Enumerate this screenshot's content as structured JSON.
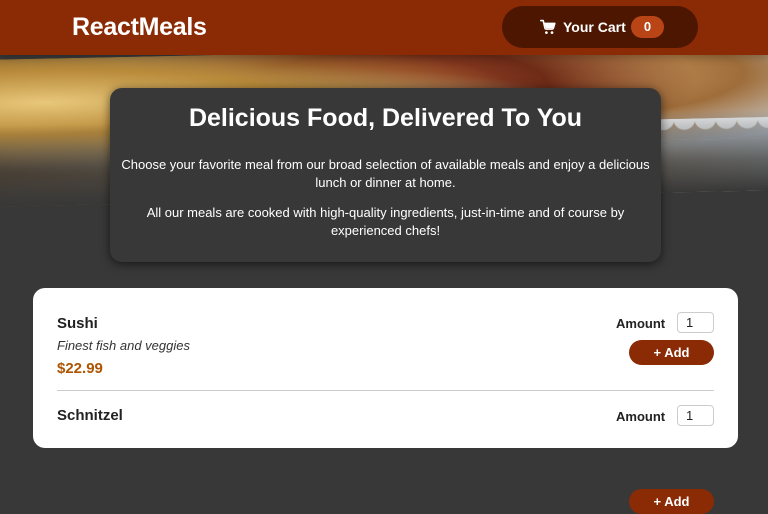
{
  "header": {
    "brand": "ReactMeals",
    "cart": {
      "label": "Your Cart",
      "count": "0",
      "icon": "cart-icon"
    }
  },
  "summary": {
    "title": "Delicious Food, Delivered To You",
    "paragraph1": "Choose your favorite meal from our broad selection of available meals and enjoy a delicious lunch or dinner at home.",
    "paragraph2": "All our meals are cooked with high-quality ingredients, just-in-time and of course by experienced chefs!"
  },
  "meals": [
    {
      "name": "Sushi",
      "description": "Finest fish and veggies",
      "price": "$22.99",
      "amount_label": "Amount",
      "amount": "1",
      "add_label": "+ Add"
    },
    {
      "name": "Schnitzel",
      "amount_label": "Amount",
      "amount": "1",
      "add_label": "+ Add"
    }
  ],
  "colors": {
    "header": "#8a2b06",
    "cart_button": "#4d1601",
    "badge": "#b94517",
    "price": "#ad5502",
    "background": "#383838"
  }
}
